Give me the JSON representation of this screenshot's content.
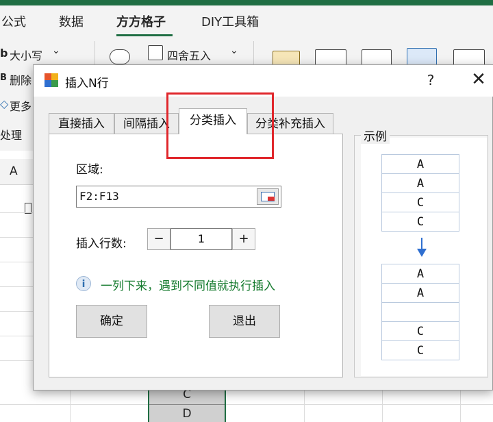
{
  "ribbon": {
    "tabs": [
      "公式",
      "数据",
      "方方格子",
      "DIY工具箱"
    ],
    "active_tab": "方方格子",
    "commands": {
      "case": "大小写",
      "delete": "删除",
      "more": "更多",
      "process": "处理",
      "round": "四舍五入"
    },
    "prefix_b1": "b",
    "prefix_b2": "B"
  },
  "sheet": {
    "col_header": "A",
    "cells": [
      "C",
      "D"
    ]
  },
  "dialog": {
    "title": "插入N行",
    "help": "?",
    "close": "✕",
    "tabs": [
      "直接插入",
      "间隔插入",
      "分类插入",
      "分类补充插入"
    ],
    "active_tab": "分类插入",
    "area_label": "区域:",
    "range_value": "F2:F13",
    "rows_label": "插入行数:",
    "minus": "−",
    "plus": "+",
    "rows_value": "1",
    "info_text": "一列下来，遇到不同值就执行插入",
    "ok_button": "确定",
    "exit_button": "退出",
    "example_label": "示例",
    "example_before": [
      "A",
      "A",
      "C",
      "C"
    ],
    "example_after": [
      "A",
      "A",
      "",
      "C",
      "C"
    ]
  },
  "colors": {
    "accent_green": "#1f6e43",
    "info_green": "#147a2d",
    "highlight_red": "#e0262b",
    "arrow_blue": "#2f6fd0"
  }
}
